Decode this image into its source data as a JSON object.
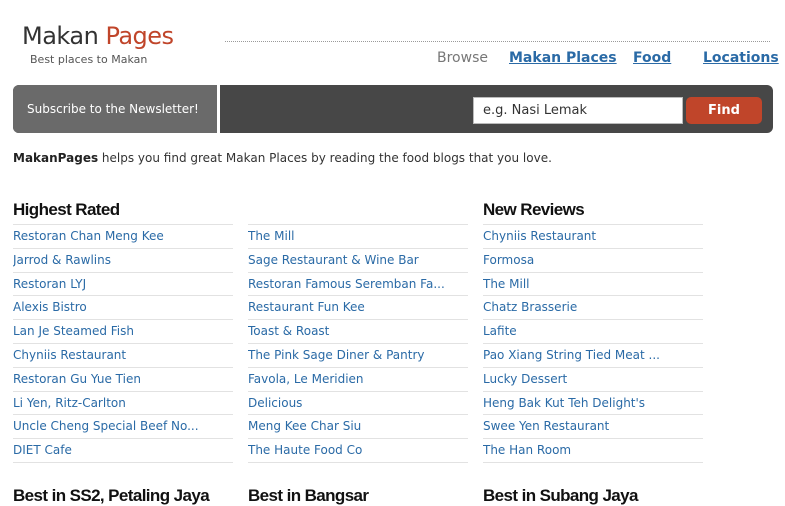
{
  "brand": {
    "word1": "Makan",
    "word2": "Pages",
    "tagline": "Best places to Makan"
  },
  "nav": {
    "browse": "Browse",
    "links": [
      "Makan Places",
      "Food",
      "Locations"
    ]
  },
  "newsletter": {
    "label": "Subscribe to the Newsletter!"
  },
  "search": {
    "placeholder": "e.g. Nasi Lemak",
    "button": "Find"
  },
  "intro": {
    "brand": "MakanPages",
    "text": " helps you find great Makan Places by reading the food blogs that you love."
  },
  "highest_rated": {
    "title": "Highest Rated",
    "col1": [
      "Restoran Chan Meng Kee",
      "Jarrod & Rawlins",
      "Restoran LYJ",
      "Alexis Bistro",
      "Lan Je Steamed Fish",
      "Chyniis Restaurant",
      "Restoran Gu Yue Tien",
      "Li Yen, Ritz-Carlton",
      "Uncle Cheng Special Beef No...",
      "DIET Cafe"
    ],
    "col2": [
      "The Mill",
      "Sage Restaurant & Wine Bar",
      "Restoran Famous Seremban Fa...",
      "Restaurant Fun Kee",
      "Toast & Roast",
      "The Pink Sage Diner & Pantry",
      "Favola, Le Meridien",
      "Delicious",
      "Meng Kee Char Siu",
      "The Haute Food Co"
    ]
  },
  "new_reviews": {
    "title": "New Reviews",
    "items": [
      "Chyniis Restaurant",
      "Formosa",
      "The Mill",
      "Chatz Brasserie",
      "Lafite",
      "Pao Xiang String Tied Meat ...",
      "Lucky Dessert",
      "Heng Bak Kut Teh Delight's",
      "Swee Yen Restaurant",
      "The Han Room"
    ]
  },
  "sections_below": [
    "Best in SS2, Petaling Jaya",
    "Best in Bangsar",
    "Best in Subang Jaya"
  ],
  "colors": {
    "accent": "#c0452a",
    "link": "#2a6aa6",
    "bar": "#474747"
  }
}
